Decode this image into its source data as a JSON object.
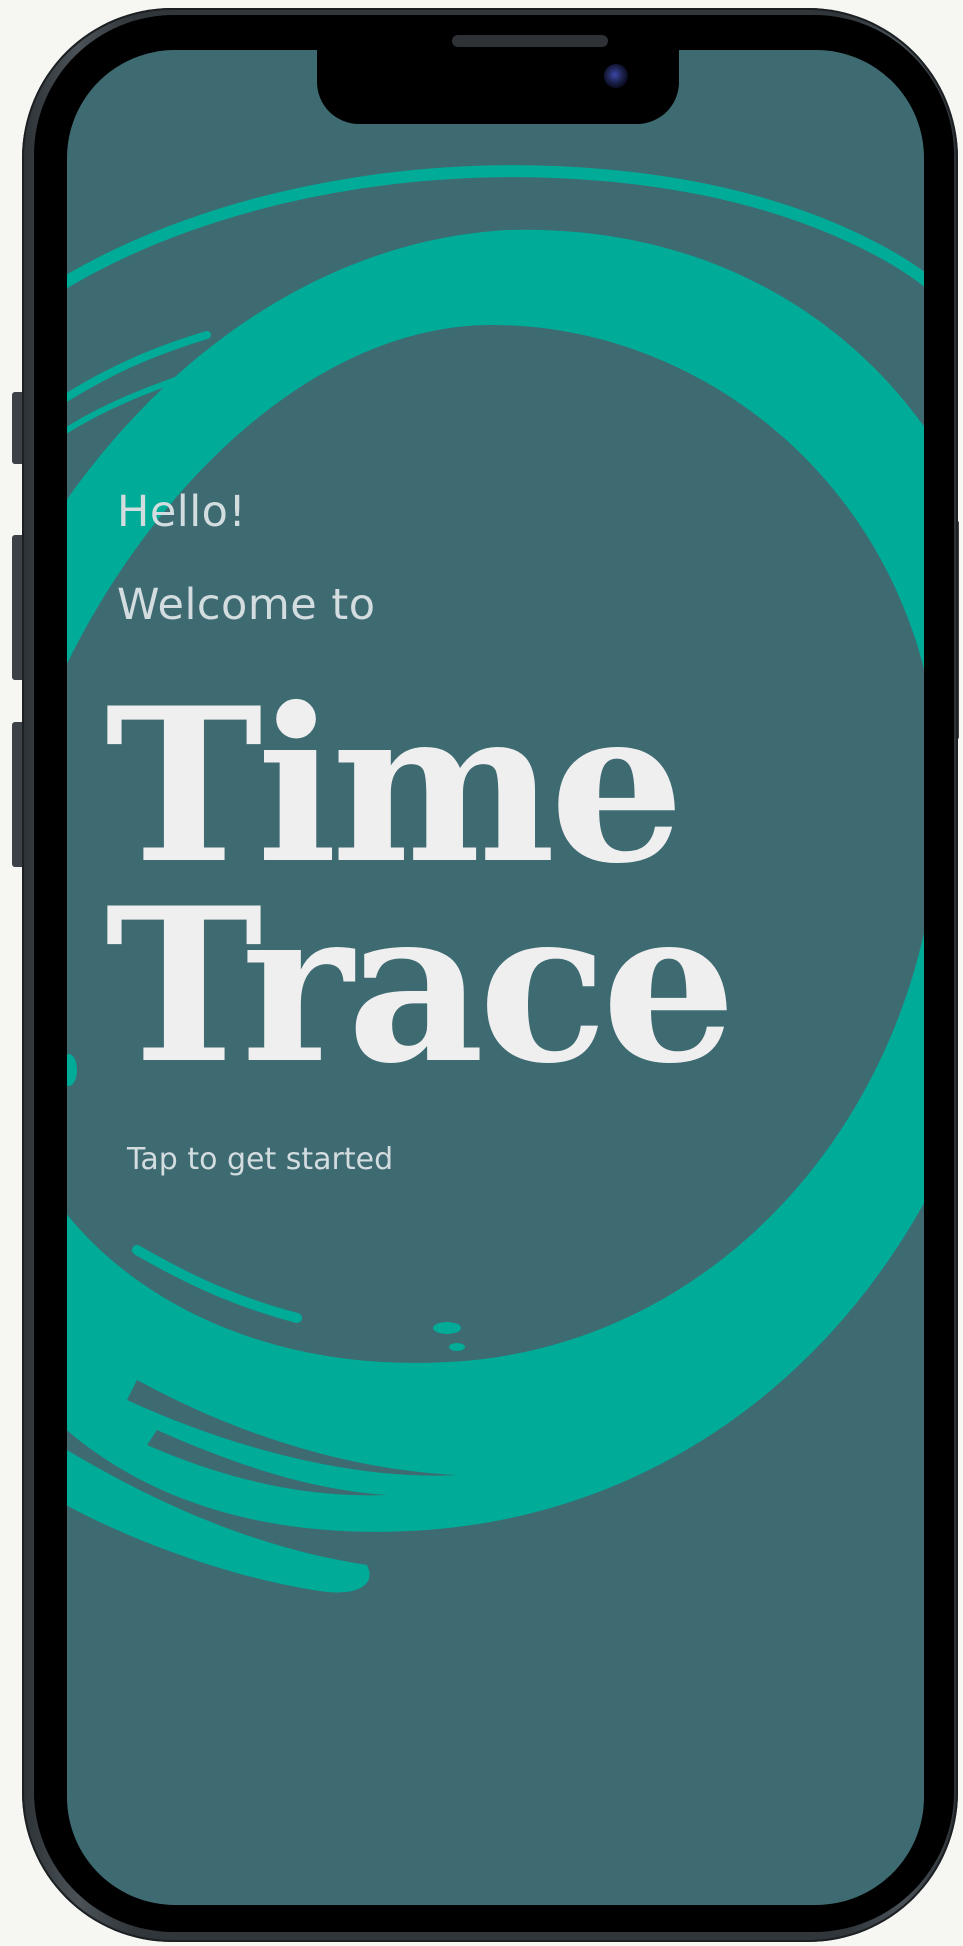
{
  "app": {
    "greeting": "Hello!",
    "welcome": "Welcome to",
    "title_line_1": "Time",
    "title_line_2": "Trace",
    "cta": "Tap to get started"
  },
  "colors": {
    "screen_background": "#3e6a72",
    "brush_ring": "#00ab97",
    "heading_text": "#efefef",
    "body_text": "#d3dcdf",
    "device_frame": "#30363a"
  },
  "icons": {
    "camera": "front-camera-icon",
    "decoration": "brush-stroke-ring-icon"
  }
}
